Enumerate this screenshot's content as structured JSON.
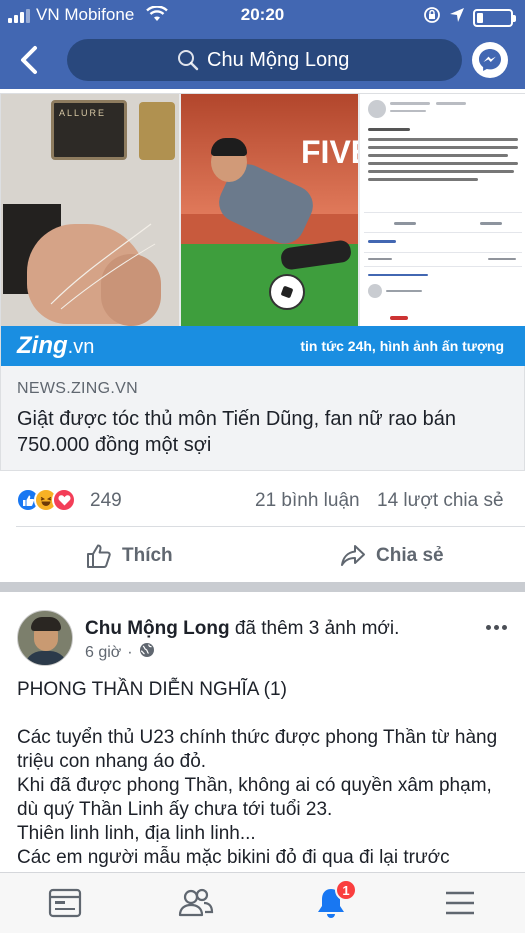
{
  "status_bar": {
    "carrier": "VN Mobifone",
    "time": "20:20"
  },
  "header": {
    "search_text": "Chu Mộng Long"
  },
  "shared_link": {
    "image_overlay": {
      "brand": "Zing",
      "brand_suffix": ".vn",
      "tagline": "tin tức 24h, hình ảnh ấn tượng",
      "perfume_label": "ALLURE"
    },
    "domain": "NEWS.ZING.VN",
    "headline": "Giật được tóc thủ môn Tiến Dũng, fan nữ rao bán 750.000 đồng một sợi"
  },
  "reactions": {
    "count": "249",
    "comments": "21 bình luận",
    "shares": "14 lượt chia sẻ"
  },
  "actions": {
    "like_label": "Thích",
    "share_label": "Chia sẻ"
  },
  "post2": {
    "author": "Chu Mộng Long",
    "action_text": " đã thêm 3 ảnh mới.",
    "time": "6 giờ",
    "separator": "·",
    "lines": [
      "PHONG THẦN DIỄN NGHĨA (1)",
      "",
      "Các tuyển thủ U23 chính thức được phong Thần từ hàng triệu con nhang áo đỏ.",
      "Khi đã được phong Thần, không ai có quyền xâm phạm, dù quý Thần Linh ấy chưa tới tuổi 23.",
      "Thiên linh linh, địa linh linh...",
      "Các em người mẫu mặc bikini đỏ đi qua đi lại trước"
    ]
  },
  "tabbar": {
    "notification_count": "1"
  },
  "colors": {
    "header_blue": "#4267b2",
    "search_bg": "#29487d",
    "zing_blue": "#1a8ee1",
    "badge_red": "#fa3e3e",
    "text_gray": "#606770"
  }
}
